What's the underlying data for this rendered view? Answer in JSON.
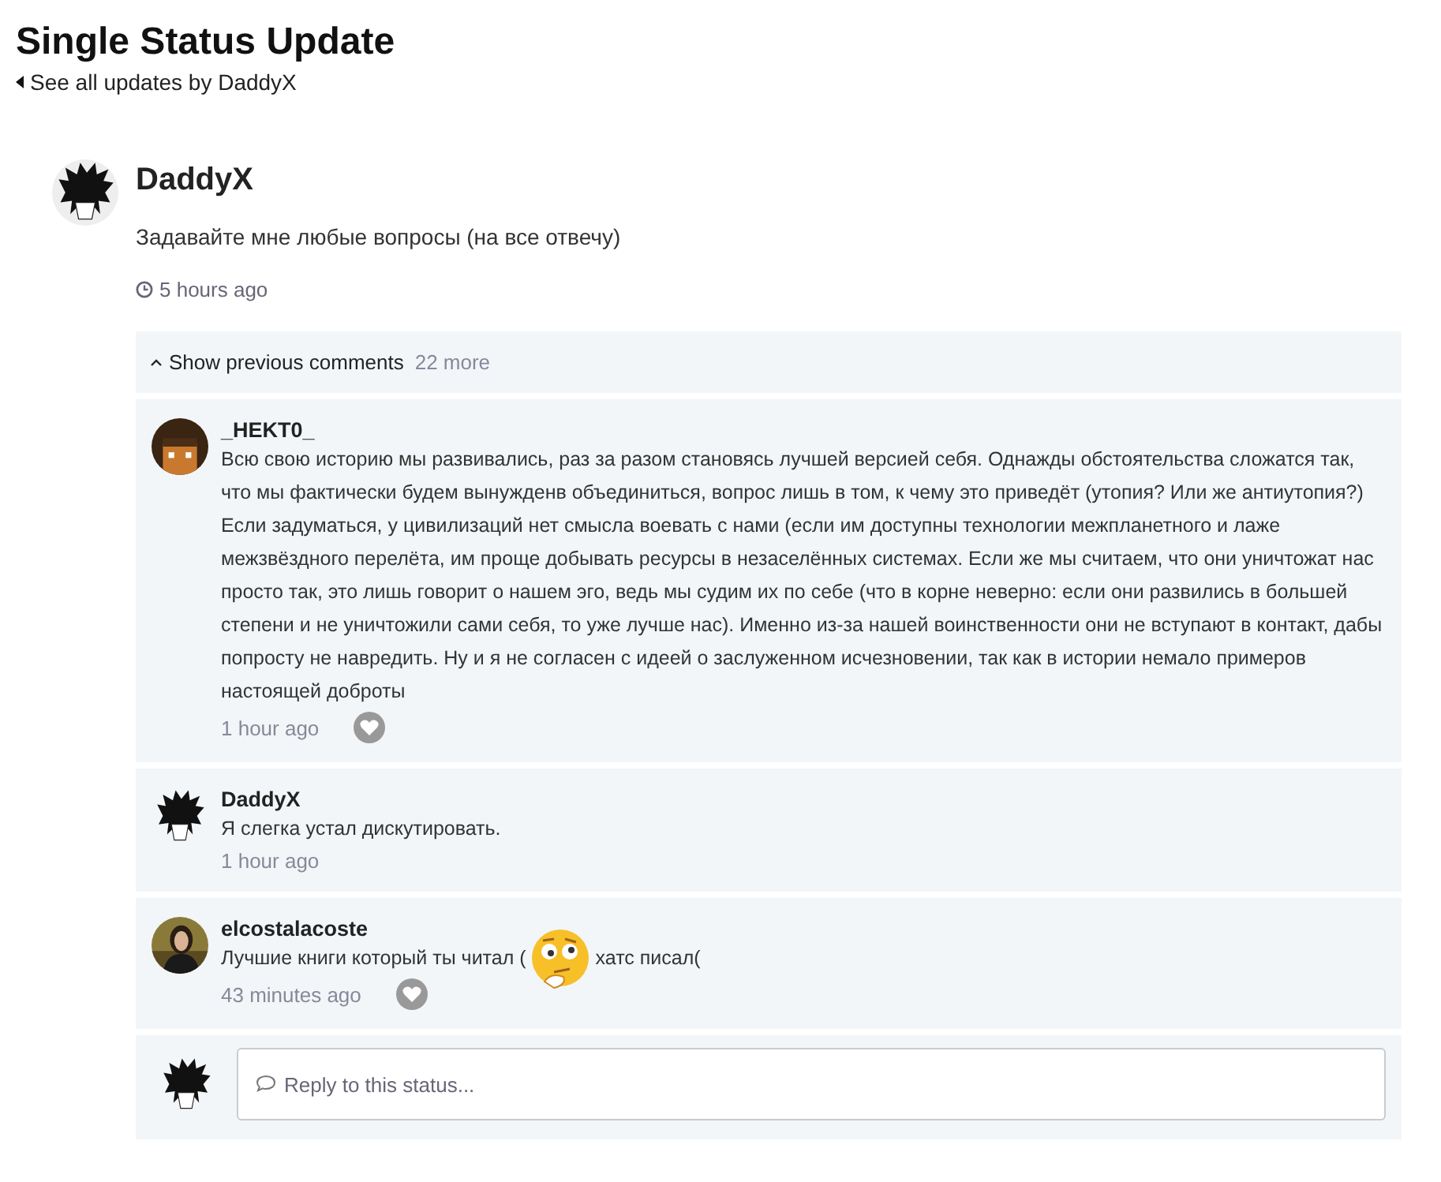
{
  "page": {
    "title": "Single Status Update",
    "back_link": "See all updates by DaddyX"
  },
  "status": {
    "author": "DaddyX",
    "avatar": {
      "kind": "spiky"
    },
    "text": "Задавайте мне любые вопросы (на все отвечу)",
    "time": "5 hours ago"
  },
  "comments_bar": {
    "label": "Show previous comments",
    "count": "22 more"
  },
  "comments": [
    {
      "author": "_HEKT0_",
      "avatar": {
        "kind": "pixel"
      },
      "body": [
        {
          "kind": "text",
          "text": "Всю свою историю мы развивались, раз за разом становясь лучшей версией себя. Однажды обстоятельства сложатся так, что мы фактически будем вынужденв объединиться, вопрос лишь в том, к чему это приведёт (утопия? Или же антиутопия?) Если задуматься, у цивилизаций нет смысла воевать с нами (если им доступны технологии межпланетного и лаже межзвёздного перелёта, им проще добывать ресурсы в незаселённых системах. Если же мы считаем, что они уничтожат нас просто так, это лишь говорит о нашем эго, ведь мы судим их по себе (что в корне неверно: если они развились в большей степени и не уничтожили сами себя, то уже лучше нас). Именно из-за нашей воинственности они не вступают в контакт, дабы попросту не навредить. Ну и я не согласен с идеей о заслуженном исчезновении, так как в истории немало примеров настоящей доброты"
        }
      ],
      "time": "1 hour ago",
      "like_button": true
    },
    {
      "author": "DaddyX",
      "avatar": {
        "kind": "spiky"
      },
      "body": [
        {
          "kind": "text",
          "text": "Я слегка устал дискутировать."
        }
      ],
      "time": "1 hour ago",
      "like_button": false
    },
    {
      "author": "elcostalacoste",
      "body": [
        {
          "kind": "text",
          "text": "Лучшие книги который ты читал ("
        },
        {
          "kind": "emoji"
        },
        {
          "kind": "text",
          "text": "хатс писал("
        }
      ],
      "time": "43 minutes ago",
      "like_button": true
    }
  ],
  "reply": {
    "avatar": {
      "kind": "spiky"
    },
    "placeholder": "Reply to this status..."
  }
}
